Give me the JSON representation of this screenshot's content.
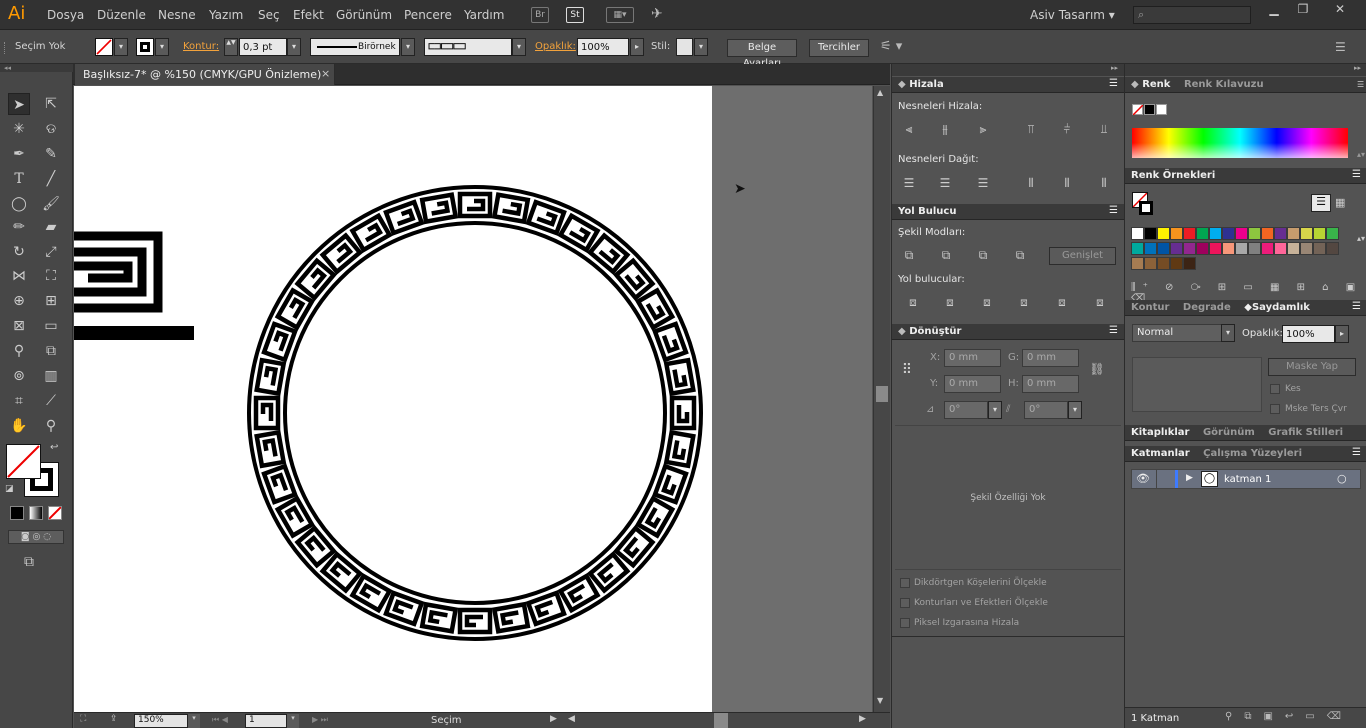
{
  "app": {
    "logo": "Ai",
    "workspace": "Asiv Tasarım"
  },
  "menus": [
    "Dosya",
    "Düzenle",
    "Nesne",
    "Yazım",
    "Seç",
    "Efekt",
    "Görünüm",
    "Pencere",
    "Yardım"
  ],
  "minibar": {
    "br": "Br",
    "st": "St"
  },
  "control": {
    "selection": "Seçim Yok",
    "stroke_label": "Kontur:",
    "stroke_value": "0,3 pt",
    "brush": "Birörnek",
    "opacity_label": "Opaklık:",
    "opacity_value": "100%",
    "style_label": "Stil:",
    "doc_setup": "Belge Ayarları",
    "prefs": "Tercihler"
  },
  "document": {
    "tab": "Başlıksız-7* @ %150 (CMYK/GPU Önizleme)"
  },
  "status": {
    "zoom": "150%",
    "page": "1",
    "mode": "Seçim"
  },
  "align": {
    "title": "Hizala",
    "align_objects": "Nesneleri Hizala:",
    "distribute": "Nesneleri Dağıt:"
  },
  "pathfinder": {
    "title": "Yol Bulucu",
    "shape_modes": "Şekil Modları:",
    "expand": "Genişlet",
    "finders": "Yol bulucular:"
  },
  "transform": {
    "title": "Dönüştür",
    "x_label": "X:",
    "x": "0 mm",
    "y_label": "Y:",
    "y": "0 mm",
    "w_label": "G:",
    "w": "0 mm",
    "h_label": "H:",
    "h": "0 mm",
    "rot": "0°",
    "shear": "0°",
    "no_props": "Şekil Özelliği Yok",
    "opt1": "Dikdörtgen Köşelerini Ölçekle",
    "opt2": "Konturları ve Efektleri Ölçekle",
    "opt3": "Piksel Izgarasına Hizala"
  },
  "color": {
    "tab1": "Renk",
    "tab2": "Renk Kılavuzu"
  },
  "swatches": {
    "title": "Renk Örnekleri",
    "colors": [
      "#ffffff",
      "#000000",
      "#fff200",
      "#f7941d",
      "#ed1c24",
      "#00a651",
      "#00aeef",
      "#2e3192",
      "#ec008c",
      "#8dc63f",
      "#f26522",
      "#662d91",
      "#c69c6d",
      "#d8d64a",
      "#b7d433",
      "#39b54a",
      "#00a99d",
      "#0072bc",
      "#0054a6",
      "#662d91",
      "#92278f",
      "#9e005d",
      "#ed145b",
      "#f7977a",
      "#a8a8a8",
      "#808080",
      "#ed1c7a",
      "#ff6699",
      "#c7b299",
      "#998675",
      "#736357",
      "#534741",
      "#a67c52",
      "#8c6239",
      "#754c24",
      "#603913",
      "#3c2415"
    ]
  },
  "transparency": {
    "tab1": "Kontur",
    "tab2": "Degrade",
    "tab3": "Saydamlık",
    "mode": "Normal",
    "opacity_label": "Opaklık:",
    "opacity": "100%",
    "mask": "Maske Yap",
    "clip": "Kes",
    "invert": "Mske Ters Çvr"
  },
  "libraries": {
    "tab1": "Kitaplıklar",
    "tab2": "Görünüm",
    "tab3": "Grafik Stilleri"
  },
  "layers": {
    "tab1": "Katmanlar",
    "tab2": "Çalışma Yüzeyleri",
    "layer1": "katman 1",
    "count": "1 Katman"
  }
}
